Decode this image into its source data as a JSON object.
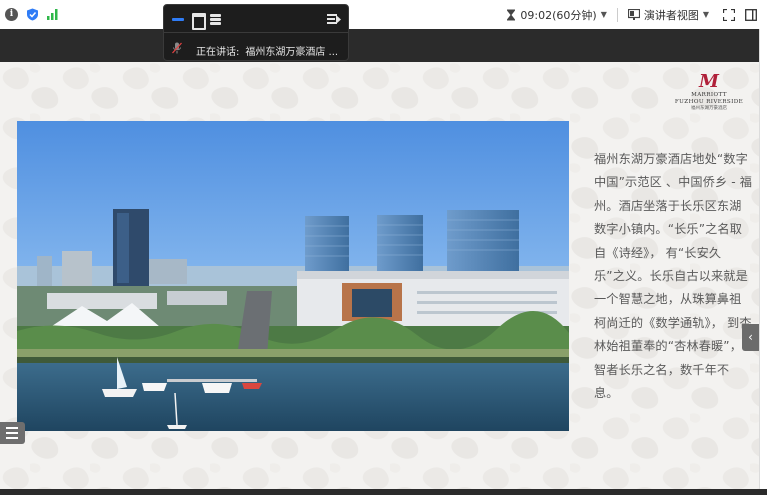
{
  "topbar": {
    "timer": "09:02(60分钟)",
    "view_mode": "演讲者视图",
    "icons": [
      "info-icon",
      "shield-icon",
      "signal-icon",
      "hourglass-icon",
      "presenter-view-icon",
      "fullscreen-icon",
      "sidebar-toggle-icon"
    ]
  },
  "float_toolbar": {
    "speaking_label": "正在讲话:",
    "speaking_name": "福州东湖万豪酒店 ..."
  },
  "slide": {
    "logo": {
      "line1": "MARRIOTT",
      "line2": "FUZHOU RIVERSIDE",
      "line3": "福州东湖万豪酒店"
    },
    "paragraph": "福州东湖万豪酒店地处“数字中国”示范区 、中国侨乡 - 福州。酒店坐落于长乐区东湖数字小镇内。“长乐”之名取自《诗经》， 有“长安久乐”之义。长乐自古以来就是一个智慧之地，从珠算鼻祖柯尚迁的《数学通轨》， 到杏林始祖董奉的“杏林春暖”，智者长乐之名，数千年不息。"
  },
  "colors": {
    "accent": "#2f7cf6",
    "brand": "#b0203a",
    "dark_bar": "#2b2b2b",
    "slide_bg": "#f3f2f0"
  }
}
